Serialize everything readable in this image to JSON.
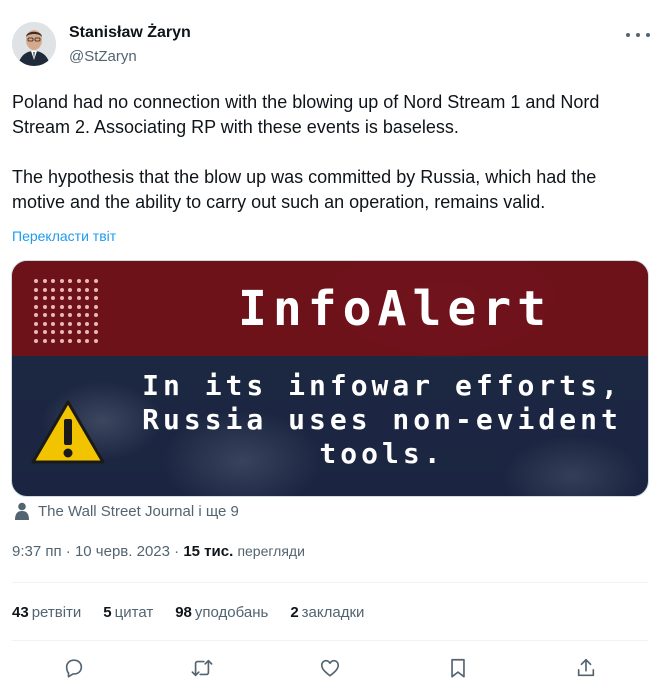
{
  "author": {
    "name": "Stanisław Żaryn",
    "handle": "@StZaryn"
  },
  "tweet": {
    "text": "Poland had no connection with the blowing up of Nord Stream 1 and Nord Stream 2. Associating RP with these events is baseless.\n\nThe hypothesis that the blow up was committed by Russia, which had the motive and the ability to carry out such an operation, remains valid.",
    "translate_label": "Перекласти твіт"
  },
  "media": {
    "title": "InfoAlert",
    "body_line1": "In its infowar efforts,",
    "body_line2": "Russia uses non-evident",
    "body_line3": "tools.",
    "accent_color": "#7a1016"
  },
  "mentions": {
    "text": "The Wall Street Journal і ще 9"
  },
  "meta": {
    "time": "9:37 пп",
    "separator": " · ",
    "date": "10 черв. 2023",
    "separator2": " · ",
    "views_count": "15 тис.",
    "views_label": "перегляди"
  },
  "stats": {
    "retweets_count": "43",
    "retweets_label": "ретвіти",
    "quotes_count": "5",
    "quotes_label": "цитат",
    "likes_count": "98",
    "likes_label": "уподобань",
    "bookmarks_count": "2",
    "bookmarks_label": "закладки"
  },
  "icons": [
    "more-icon",
    "person-icon",
    "reply-icon",
    "retweet-icon",
    "like-icon",
    "bookmark-icon",
    "share-icon",
    "warning-icon"
  ]
}
